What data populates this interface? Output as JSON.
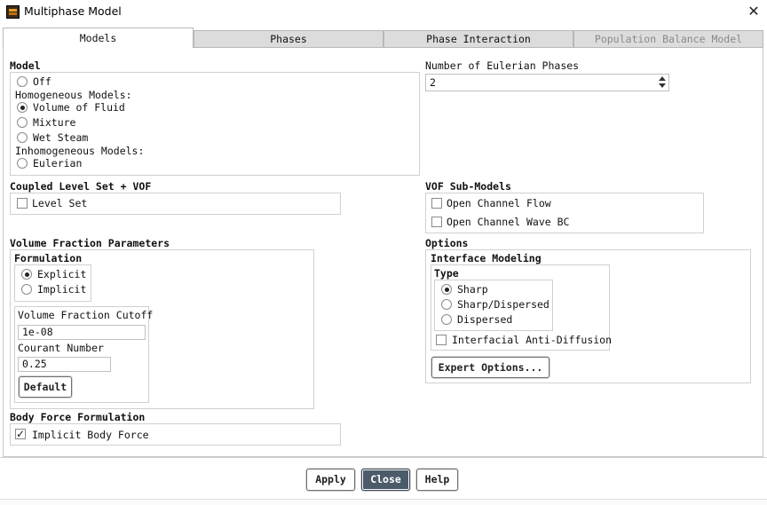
{
  "window": {
    "title": "Multiphase Model"
  },
  "tabs": [
    {
      "label": "Models",
      "active": true,
      "enabled": true
    },
    {
      "label": "Phases",
      "active": false,
      "enabled": true
    },
    {
      "label": "Phase Interaction",
      "active": false,
      "enabled": true
    },
    {
      "label": "Population Balance Model",
      "active": false,
      "enabled": false
    }
  ],
  "model": {
    "label": "Model",
    "off_label": "Off",
    "homogeneous_label": "Homogeneous Models:",
    "vof_label": "Volume of Fluid",
    "mixture_label": "Mixture",
    "wet_steam_label": "Wet Steam",
    "inhomogeneous_label": "Inhomogeneous Models:",
    "eulerian_label": "Eulerian",
    "selected": "Volume of Fluid"
  },
  "eulerian_phases": {
    "label": "Number of Eulerian Phases",
    "value": "2"
  },
  "coupled_level_set": {
    "label": "Coupled Level Set + VOF",
    "level_set_label": "Level Set",
    "level_set_checked": false
  },
  "vof_submodels": {
    "label": "VOF Sub-Models",
    "open_channel_flow_label": "Open Channel Flow",
    "open_channel_flow_checked": false,
    "open_channel_wave_label": "Open Channel Wave BC",
    "open_channel_wave_checked": false
  },
  "vf_params": {
    "label": "Volume Fraction Parameters",
    "formulation_label": "Formulation",
    "explicit_label": "Explicit",
    "implicit_label": "Implicit",
    "selected": "Explicit",
    "cutoff_label": "Volume Fraction Cutoff",
    "cutoff_value": "1e-08",
    "courant_label": "Courant Number",
    "courant_value": "0.25",
    "default_label": "Default"
  },
  "options": {
    "label": "Options",
    "interface_label": "Interface Modeling",
    "type_label": "Type",
    "sharp_label": "Sharp",
    "sharp_dispersed_label": "Sharp/Dispersed",
    "dispersed_label": "Dispersed",
    "selected": "Sharp",
    "anti_diffusion_label": "Interfacial Anti-Diffusion",
    "anti_diffusion_checked": false,
    "expert_label": "Expert Options..."
  },
  "body_force": {
    "label": "Body Force Formulation",
    "implicit_label": "Implicit Body Force",
    "implicit_checked": true,
    "check_glyph": "✓"
  },
  "footer": {
    "apply_label": "Apply",
    "close_label": "Close",
    "help_label": "Help"
  },
  "icons": {
    "close_glyph": "✕"
  },
  "colors": {
    "primary_button": "#4c5b6a",
    "tab_inactive": "#dcdcdc"
  }
}
